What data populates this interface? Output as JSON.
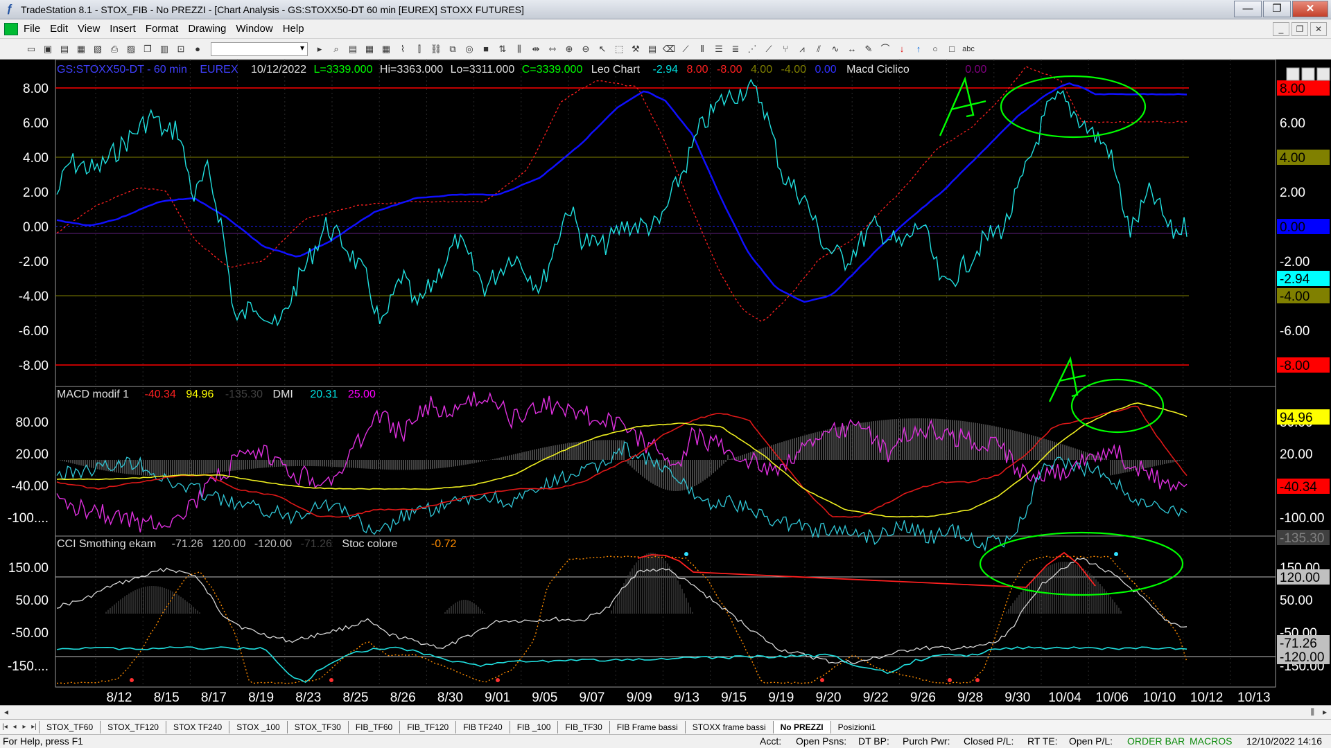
{
  "window": {
    "title": "TradeStation 8.1 - STOX_FIB - No PREZZI - [Chart Analysis - GS:STOXX50-DT  60 min  [EUREX] STOXX FUTURES]",
    "minimize_label": "—",
    "maximize_label": "❐",
    "close_label": "✕"
  },
  "menu": {
    "items": [
      "File",
      "Edit",
      "View",
      "Insert",
      "Format",
      "Drawing",
      "Window",
      "Help"
    ],
    "mdi_buttons": [
      "_",
      "❐",
      "✕"
    ]
  },
  "toolbar": {
    "dropdown_value": "▾"
  },
  "chart": {
    "header": {
      "symbol": "GS:STOXX50-DT - 60 min",
      "exchange": "EUREX",
      "date": "10/12/2022",
      "last": "L=3339.000",
      "high": "Hi=3363.000",
      "low": "Lo=3311.000",
      "close": "C=3339.000",
      "indicator": "Leo Chart",
      "v1": "-2.94",
      "v2": "8.00",
      "v3": "-8.00",
      "v4": "4.00",
      "v5": "-4.00",
      "v6": "0.00",
      "indicator2": "Macd Ciclico",
      "v7": "0.00"
    },
    "panel2_header": {
      "name": "MACD modif 1",
      "v1": "-40.34",
      "v2": "94.96",
      "v3": "-135.30",
      "dmi": "DMI",
      "v4": "20.31",
      "v5": "25.00"
    },
    "panel3_header": {
      "name": "CCI Smothing ekam",
      "v1": "-71.26",
      "v2": "120.00",
      "v3": "-120.00",
      "v4": "-71.26",
      "stoc": "Stoc colore",
      "v5": "-0.72"
    },
    "panel1_axis": [
      "8.00",
      "6.00",
      "4.00",
      "2.00",
      "0.00",
      "-2.00",
      "-4.00",
      "-6.00",
      "-8.00"
    ],
    "panel2_axis": [
      "80.00",
      "20.00",
      "-40.00",
      "-100...."
    ],
    "panel2_right_axis": [
      "80.00",
      "20.00",
      "-100.00"
    ],
    "panel3_axis": [
      "150.00",
      "50.00",
      "-50.00",
      "-150...."
    ],
    "panel3_right_axis": [
      "150.00",
      "50.00",
      "-50.00",
      "-150.00"
    ],
    "right_badges_p1": [
      {
        "text": "8.00",
        "bg": "#ff0000",
        "fg": "#000000"
      },
      {
        "text": "4.00",
        "bg": "#808000",
        "fg": "#000000"
      },
      {
        "text": "0.00",
        "bg": "#0000ff",
        "fg": "#000000"
      },
      {
        "text": "-2.94",
        "bg": "#00ffff",
        "fg": "#000000"
      },
      {
        "text": "-4.00",
        "bg": "#808000",
        "fg": "#000000"
      },
      {
        "text": "-8.00",
        "bg": "#ff0000",
        "fg": "#000000"
      }
    ],
    "right_badges_p2": [
      {
        "text": "94.96",
        "bg": "#ffff00",
        "fg": "#000000"
      },
      {
        "text": "-40.34",
        "bg": "#ff0000",
        "fg": "#000000"
      },
      {
        "text": "-135.30",
        "bg": "#404040",
        "fg": "#808080"
      }
    ],
    "right_badges_p3": [
      {
        "text": "120.00",
        "bg": "#c0c0c0",
        "fg": "#000000"
      },
      {
        "text": "-71.26",
        "bg": "#c0c0c0",
        "fg": "#000000"
      },
      {
        "text": "-120.00",
        "bg": "#c0c0c0",
        "fg": "#000000"
      }
    ],
    "x_labels": [
      "8/12",
      "8/15",
      "8/17",
      "8/19",
      "8/23",
      "8/25",
      "8/26",
      "8/30",
      "9/01",
      "9/05",
      "9/07",
      "9/09",
      "9/13",
      "9/15",
      "9/19",
      "9/20",
      "9/22",
      "9/26",
      "9/28",
      "9/30",
      "10/04",
      "10/06",
      "10/10",
      "10/12",
      "10/13"
    ],
    "annotation_letter": "A",
    "colors": {
      "cyan": "#00ffff",
      "blue": "#0000ff",
      "red": "#ff0000",
      "yellow": "#ffff00",
      "magenta": "#ff00ff",
      "orange": "#ff8c00",
      "olive": "#808000",
      "green_annotation": "#00ff00"
    }
  },
  "tabs": [
    "STOX_TF60",
    "STOX_TF120",
    "STOX TF240",
    "STOX _100",
    "STOX_TF30",
    "FIB_TF60",
    "FIB_TF120",
    "FIB TF240",
    "FIB _100",
    "FIB_TF30",
    "FIB Frame bassi",
    "STOXX frame bassi",
    "No PREZZI",
    "Posizioni1"
  ],
  "active_tab": "No PREZZI",
  "status": {
    "help": "For Help, press F1",
    "acct": "Acct:",
    "open_psns": "Open Psns:",
    "dt_bp": "DT BP:",
    "purch_pwr": "Purch Pwr:",
    "closed_pl": "Closed P/L:",
    "rt_te": "RT TE:",
    "open_pl": "Open P/L:",
    "order_bar": "ORDER BAR",
    "macros": "MACROS",
    "datetime": "12/10/2022 14:16"
  }
}
